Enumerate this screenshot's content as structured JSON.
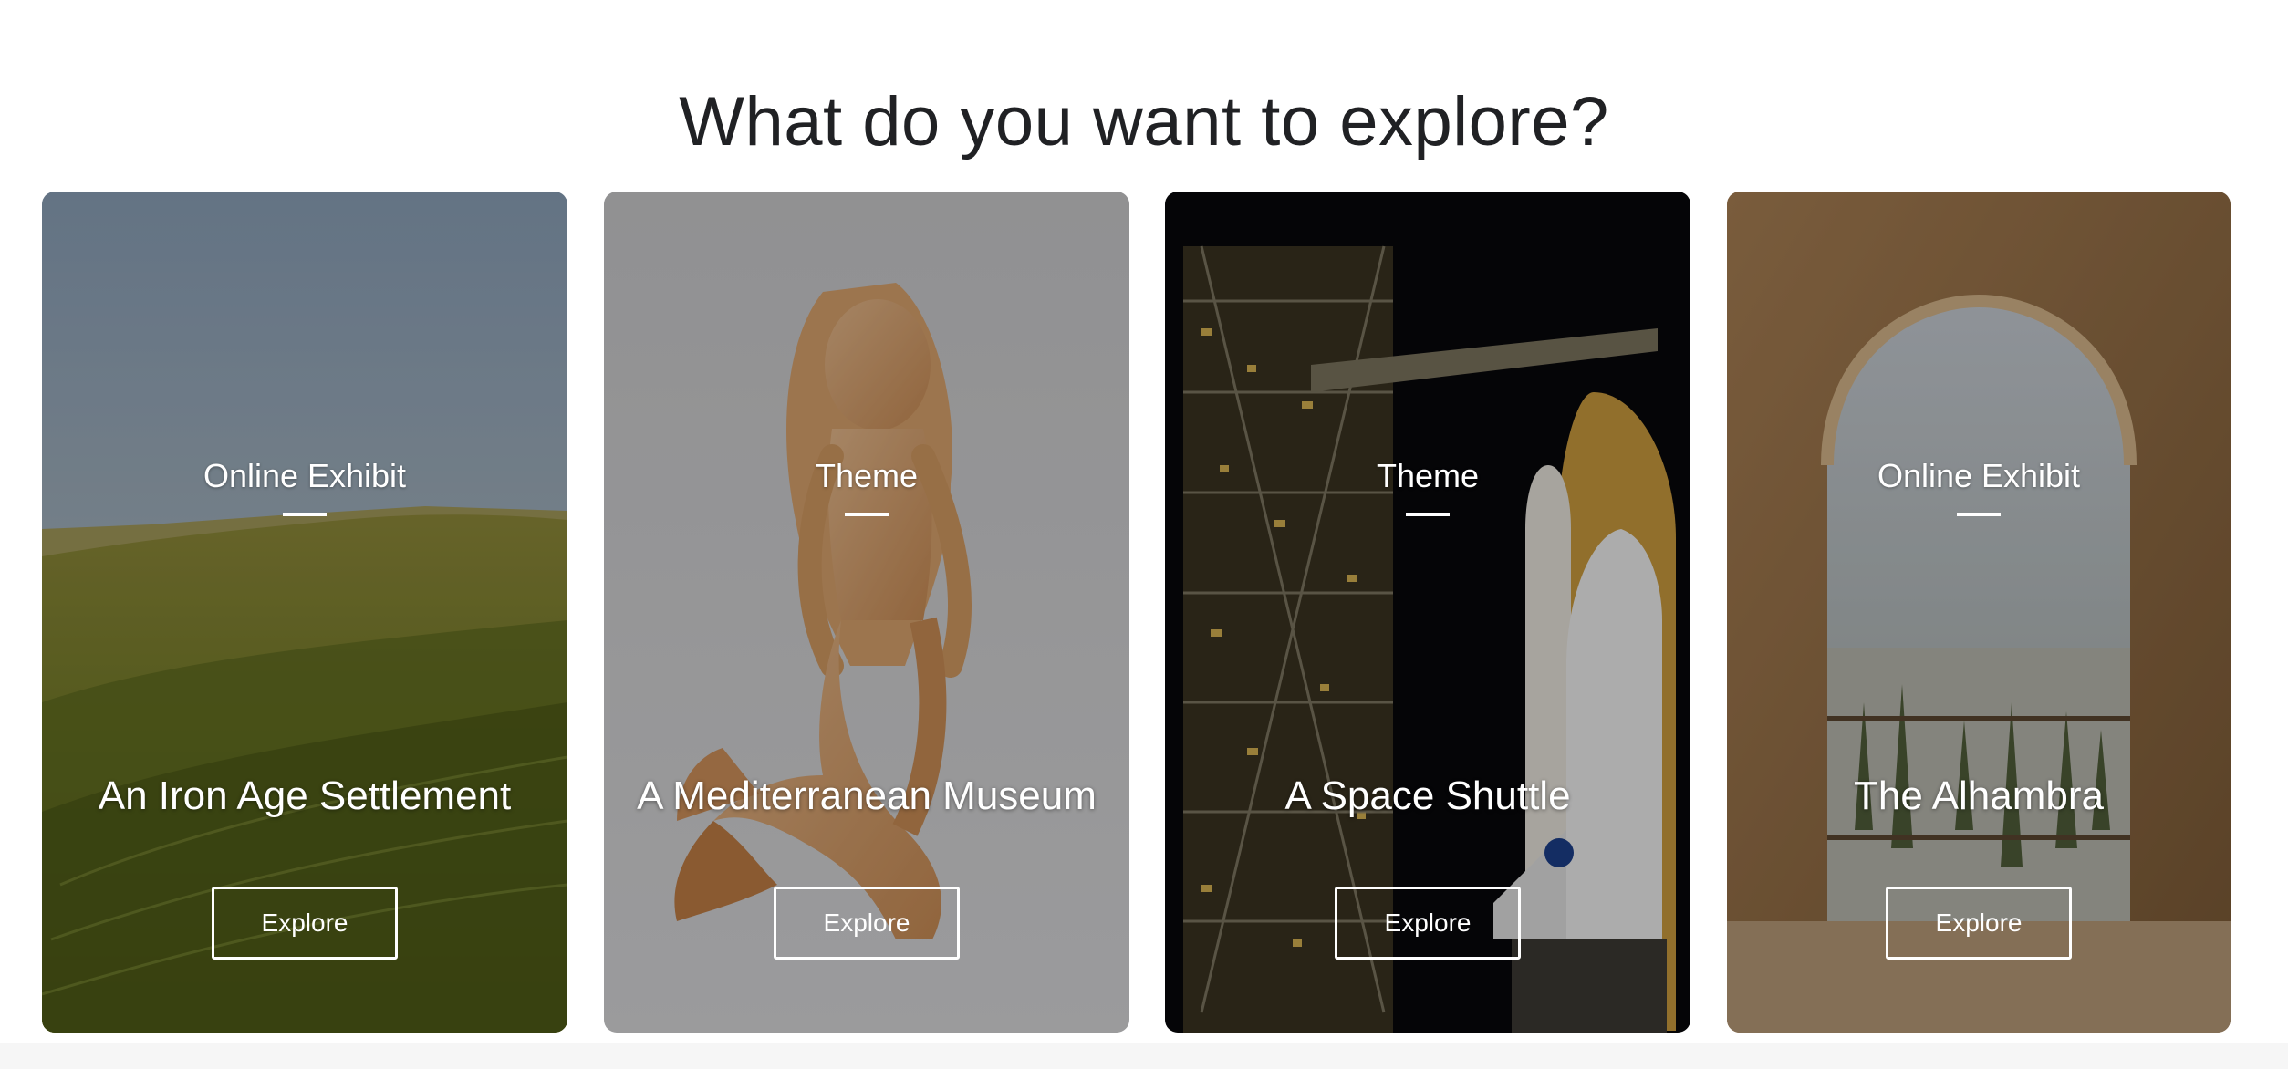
{
  "page": {
    "heading": "What do you want to explore?"
  },
  "cards": [
    {
      "kind": "Online Exhibit",
      "title": "An Iron Age Settlement",
      "button_label": "Explore",
      "image_subject": "grassy-hillfort-landscape"
    },
    {
      "kind": "Theme",
      "title": "A Mediterranean Museum",
      "button_label": "Explore",
      "image_subject": "terracotta-mermaid-relief"
    },
    {
      "kind": "Theme",
      "title": "A Space Shuttle",
      "button_label": "Explore",
      "image_subject": "space-shuttle-on-launch-pad"
    },
    {
      "kind": "Online Exhibit",
      "title": "The Alhambra",
      "button_label": "Explore",
      "image_subject": "moorish-arch-over-city-view"
    }
  ],
  "colors": {
    "heading_text": "#202124",
    "card_text": "#ffffff",
    "page_background": "#ffffff"
  }
}
